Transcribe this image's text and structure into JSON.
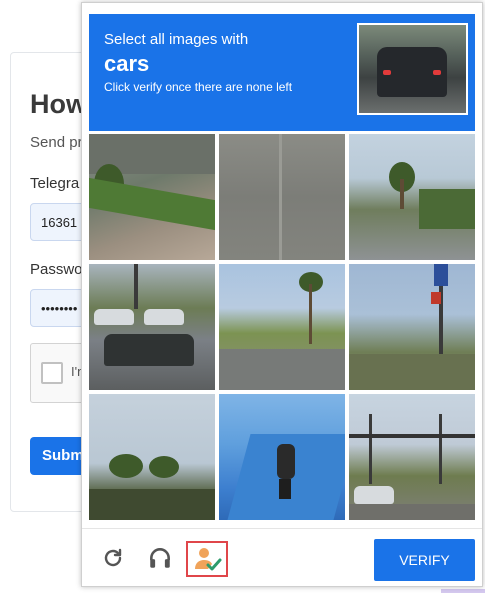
{
  "background_form": {
    "title": "How",
    "subtitle": "Send pr",
    "telegram_label": "Telegra",
    "telegram_value": "16361",
    "password_label": "Passwo",
    "password_value": "••••••••",
    "recaptcha_text": "I'n",
    "submit_label": "Subm"
  },
  "challenge": {
    "instruction_line1": "Select all images with",
    "keyword": "cars",
    "instruction_line3": "Click verify once there are none left",
    "tiles": [
      {
        "id": 1,
        "desc": "house-lawn-street"
      },
      {
        "id": 2,
        "desc": "asphalt-road"
      },
      {
        "id": 3,
        "desc": "hillside-road-palms"
      },
      {
        "id": 4,
        "desc": "parking-lot-cars"
      },
      {
        "id": 5,
        "desc": "road-palm-trees"
      },
      {
        "id": 6,
        "desc": "street-sign-sky"
      },
      {
        "id": 7,
        "desc": "palm-trees-sky"
      },
      {
        "id": 8,
        "desc": "motorcycle-rider-road"
      },
      {
        "id": 9,
        "desc": "intersection-traffic-lights"
      }
    ],
    "verify_label": "VERIFY"
  },
  "icons": {
    "reload": "reload-icon",
    "audio": "headphones-icon",
    "info": "person-check-icon"
  },
  "colors": {
    "accent": "#1a73e8",
    "highlight_border": "#e0464a",
    "info_person": "#f0a35a",
    "info_check": "#2e9b6b"
  }
}
